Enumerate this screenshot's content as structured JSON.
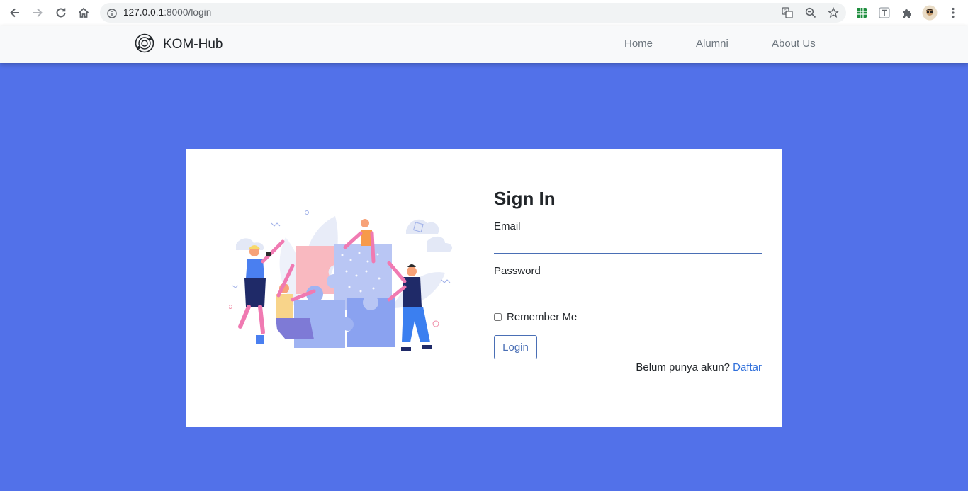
{
  "browser": {
    "url_host": "127.0.0.1",
    "url_path": ":8000/login",
    "icons": [
      "back-icon",
      "forward-icon",
      "reload-icon",
      "home-icon",
      "site-info-icon",
      "translate-icon",
      "zoom-icon",
      "bookmark-star-icon",
      "sheets-extension-icon",
      "text-extension-icon",
      "extensions-puzzle-icon",
      "profile-avatar",
      "menu-dots-icon"
    ]
  },
  "navbar": {
    "brand": "KOM-Hub",
    "links": [
      "Home",
      "Alumni",
      "About Us"
    ]
  },
  "login": {
    "title": "Sign In",
    "email_label": "Email",
    "email_value": "",
    "password_label": "Password",
    "password_value": "",
    "remember_label": "Remember Me",
    "button_label": "Login",
    "register_prompt": "Belum punya akun?",
    "register_link": "Daftar"
  },
  "colors": {
    "page_background": "#5271e9",
    "accent": "#4a6fb5",
    "link": "#2f6fdb"
  }
}
